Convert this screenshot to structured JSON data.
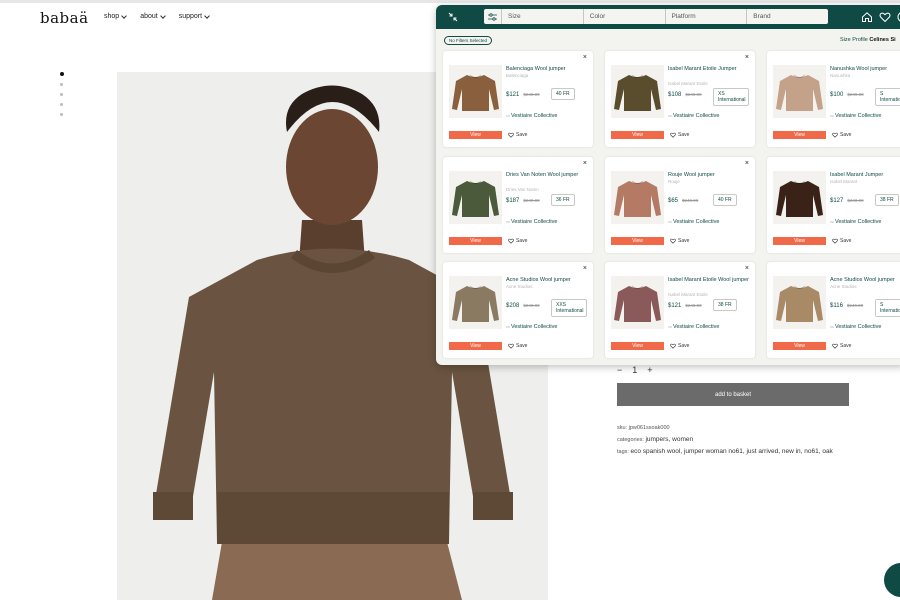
{
  "site": {
    "logo": "babaä",
    "nav": [
      "shop",
      "about",
      "support"
    ]
  },
  "product": {
    "quantity": "1",
    "minus": "−",
    "plus": "+",
    "add_to_basket": "add to basket",
    "sku_label": "sku:",
    "sku": "jpw061ssoak000",
    "categories_label": "categories:",
    "categories": "jumpers, women",
    "tags_label": "tags:",
    "tags": "eco spanish wool, jumper woman no61, just arrived, new in, no61, oak"
  },
  "panel": {
    "filters": [
      "Size",
      "Color",
      "Platform",
      "Brand"
    ],
    "no_filters": "No Filters Selected",
    "size_profile_label": "Size Profile",
    "size_profile_name": "Celines Si",
    "view_label": "View",
    "save_label": "Save",
    "close_glyph": "×",
    "cards": [
      {
        "title": "Balenciaga Wool jumper",
        "brand": "Balenciaga",
        "price": "$121",
        "old_price": "$240.00",
        "size": "40 FR",
        "seller": "Vestiaire Collective",
        "color": "#8a5f3e"
      },
      {
        "title": "Isabel Marant Etoile Jumper",
        "brand": "Isabel Marant Etoile",
        "price": "$108",
        "old_price": "$240.00",
        "size": "XS International",
        "seller": "Vestiaire Collective",
        "color": "#5a4d2e"
      },
      {
        "title": "Nanushka Wool jumper",
        "brand": "Nanushka",
        "price": "$100",
        "old_price": "$240.00",
        "size": "S International",
        "seller": "Vestiaire Collective",
        "color": "#c4a28a"
      },
      {
        "title": "Dries Van Noten Wool jumper",
        "brand": "Dries Van Noten",
        "price": "$187",
        "old_price": "$240.00",
        "size": "36 FR",
        "seller": "Vestiaire Collective",
        "color": "#4a5a3a"
      },
      {
        "title": "Rouje Wool jumper",
        "brand": "Rouje",
        "price": "$65",
        "old_price": "$240.00",
        "size": "40 FR",
        "seller": "Vestiaire Collective",
        "color": "#b57a64"
      },
      {
        "title": "Isabel Marant Jumper",
        "brand": "Isabel Marant",
        "price": "$127",
        "old_price": "$240.00",
        "size": "38 FR",
        "seller": "Vestiaire Collective",
        "color": "#3a2218"
      },
      {
        "title": "Acne Studios Wool jumper",
        "brand": "Acne Studios",
        "price": "$208",
        "old_price": "$240.00",
        "size": "XXS International",
        "seller": "Vestiaire Collective",
        "color": "#8a7a62"
      },
      {
        "title": "Isabel Marant Etoile Wool jumper",
        "brand": "Isabel Marant Etoile",
        "price": "$121",
        "old_price": "$240.00",
        "size": "38 FR",
        "seller": "Vestiaire Collective",
        "color": "#8a5a5a"
      },
      {
        "title": "Acne Studios Wool jumper",
        "brand": "Acne Studios",
        "price": "$116",
        "old_price": "$240.00",
        "size": "S International",
        "seller": "Vestiaire Collective",
        "color": "#a88a66"
      }
    ]
  },
  "colors": {
    "brand_green": "#0f4a44",
    "view_orange": "#f06a4a",
    "basket_gray": "#6b6b6b",
    "sweater_brown": "#6a5340"
  },
  "icons": [
    "collapse-icon",
    "filter-sliders-icon",
    "home-icon",
    "heart-icon",
    "account-icon",
    "close-icon",
    "chat-icon"
  ]
}
